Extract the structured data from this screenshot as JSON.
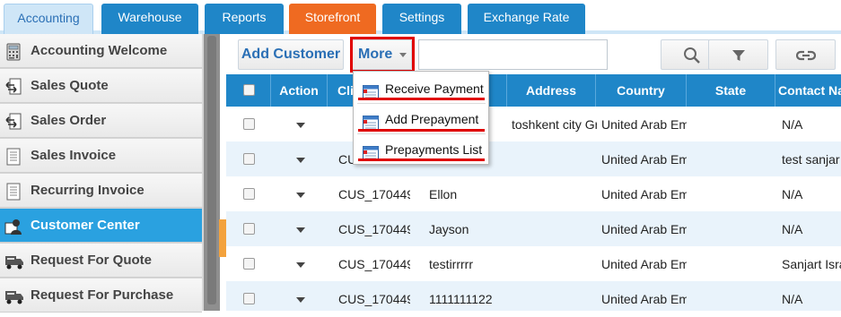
{
  "tabs": [
    {
      "label": "Accounting",
      "state": "active"
    },
    {
      "label": "Warehouse",
      "state": "normal"
    },
    {
      "label": "Reports",
      "state": "normal"
    },
    {
      "label": "Storefront",
      "state": "highlight"
    },
    {
      "label": "Settings",
      "state": "normal"
    },
    {
      "label": "Exchange Rate",
      "state": "normal"
    }
  ],
  "sidebar": {
    "items": [
      {
        "label": "Accounting Welcome",
        "icon": "calculator-icon"
      },
      {
        "label": "Sales Quote",
        "icon": "exchange-doc-icon"
      },
      {
        "label": "Sales Order",
        "icon": "exchange-doc-icon"
      },
      {
        "label": "Sales Invoice",
        "icon": "document-icon"
      },
      {
        "label": "Recurring Invoice",
        "icon": "document-icon"
      },
      {
        "label": "Customer Center",
        "icon": "customer-icon",
        "active": true
      },
      {
        "label": "Request For Quote",
        "icon": "truck-icon"
      },
      {
        "label": "Request For Purchase",
        "icon": "truck-icon"
      }
    ]
  },
  "toolbar": {
    "add_customer_label": "Add Customer",
    "more_label": "More",
    "search_value": "",
    "search_placeholder": ""
  },
  "dropdown": {
    "items": [
      {
        "label": "Receive Payment",
        "icon": "form-icon"
      },
      {
        "label": "Add Prepayment",
        "icon": "form-icon"
      },
      {
        "label": "Prepayments List",
        "icon": "form-icon"
      }
    ]
  },
  "grid": {
    "columns": [
      "",
      "Action",
      "Cli",
      "",
      "Address",
      "Country",
      "State",
      "Contact Na"
    ],
    "rows": [
      {
        "id": "",
        "name": "",
        "address": "toshkent city Gr",
        "country": "United Arab Em",
        "state": "",
        "contact": "N/A"
      },
      {
        "id": "CU",
        "name": "",
        "address": "",
        "country": "United Arab Em",
        "state": "",
        "contact": "test sanjar t"
      },
      {
        "id": "CUS_170449",
        "name": "Ellon",
        "address": "",
        "country": "United Arab Em",
        "state": "",
        "contact": "N/A"
      },
      {
        "id": "CUS_170449",
        "name": "Jayson",
        "address": "",
        "country": "United Arab Em",
        "state": "",
        "contact": "N/A"
      },
      {
        "id": "CUS_170449",
        "name": "testirrrrr",
        "address": "",
        "country": "United Arab Em",
        "state": "",
        "contact": "Sanjart Isra"
      },
      {
        "id": "CUS_170449",
        "name": "1111111122",
        "address": "",
        "country": "United Arab Em",
        "state": "",
        "contact": "N/A"
      }
    ]
  },
  "colors": {
    "tab_blue": "#1f86c8",
    "tab_orange": "#ef6a21",
    "header_blue": "#1f86c8",
    "sidebar_active": "#2aa1e0",
    "highlight_red": "#e00000"
  }
}
